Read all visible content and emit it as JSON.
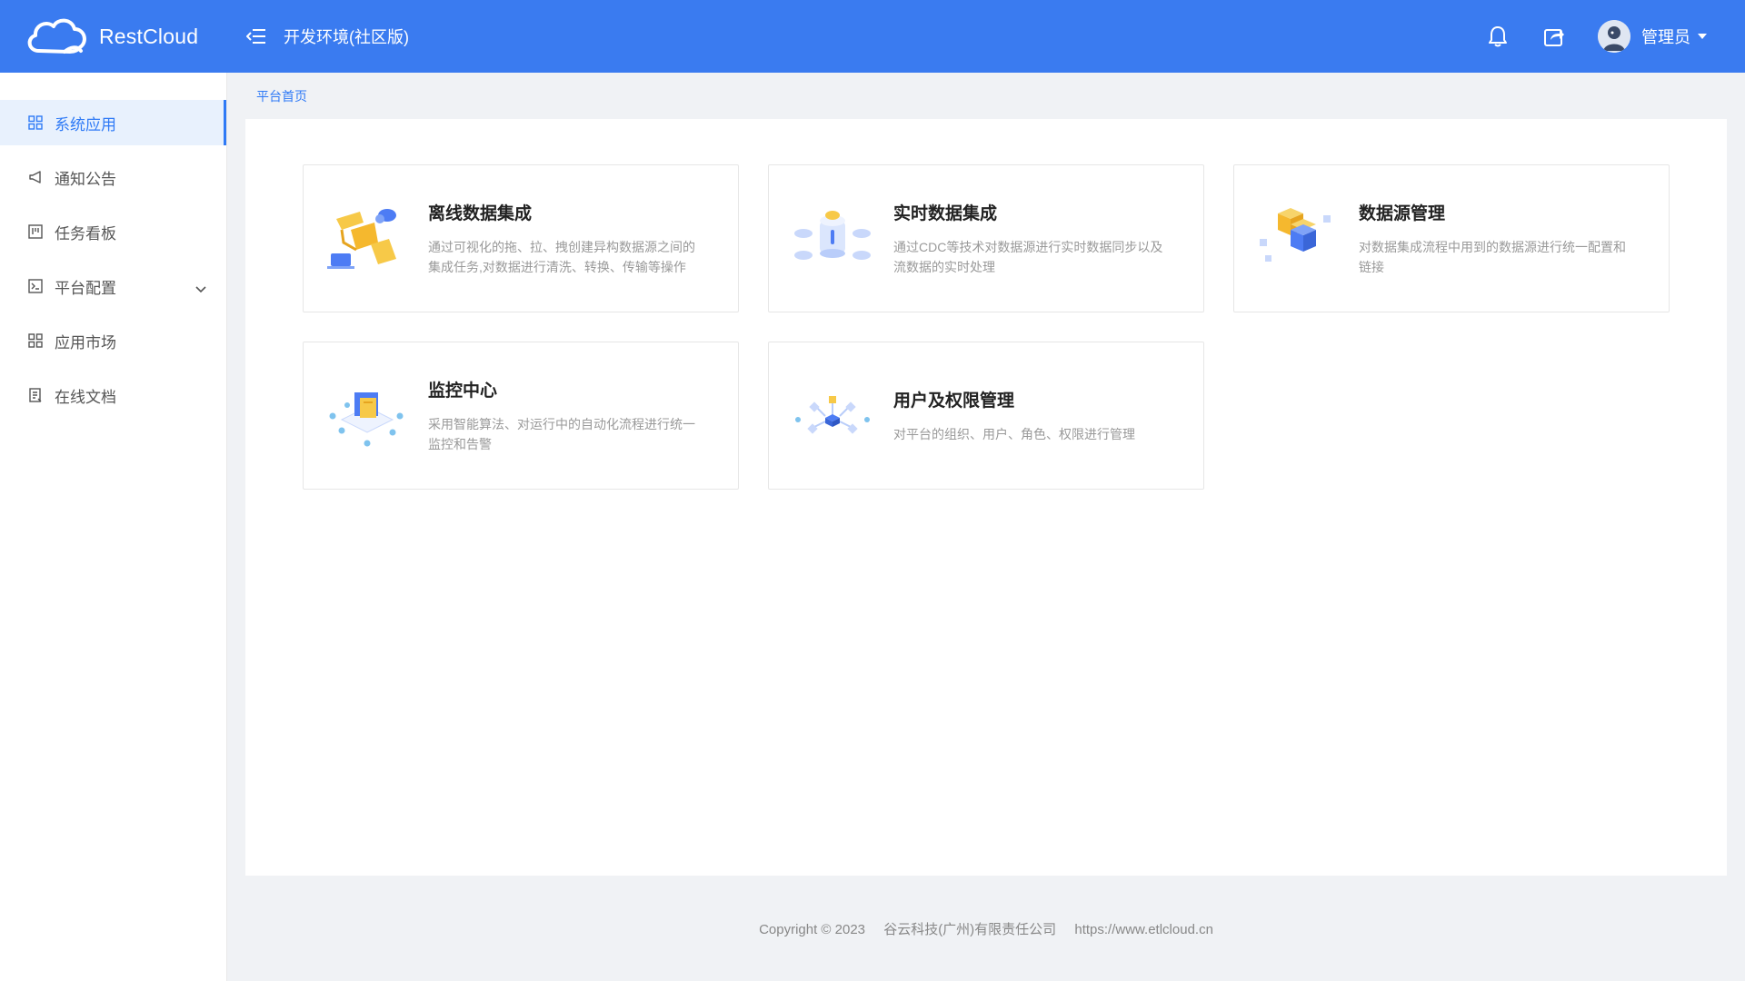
{
  "header": {
    "brand": "RestCloud",
    "env_title": "开发环境(社区版)",
    "user_name": "管理员",
    "icons": [
      "menu-fold-icon",
      "bell-icon",
      "share-icon"
    ]
  },
  "sidebar": {
    "items": [
      {
        "label": "系统应用",
        "icon": "grid-icon",
        "active": true
      },
      {
        "label": "通知公告",
        "icon": "megaphone-icon"
      },
      {
        "label": "任务看板",
        "icon": "kanban-icon"
      },
      {
        "label": "平台配置",
        "icon": "terminal-icon",
        "expandable": true
      },
      {
        "label": "应用市场",
        "icon": "grid-icon"
      },
      {
        "label": "在线文档",
        "icon": "document-icon"
      }
    ]
  },
  "breadcrumb": "平台首页",
  "cards": [
    {
      "title": "离线数据集成",
      "desc": "通过可视化的拖、拉、拽创建异构数据源之间的集成任务,对数据进行清洗、转换、传输等操作"
    },
    {
      "title": "实时数据集成",
      "desc": "通过CDC等技术对数据源进行实时数据同步以及流数据的实时处理"
    },
    {
      "title": "数据源管理",
      "desc": "对数据集成流程中用到的数据源进行统一配置和链接"
    },
    {
      "title": "监控中心",
      "desc": "采用智能算法、对运行中的自动化流程进行统一监控和告警"
    },
    {
      "title": "用户及权限管理",
      "desc": "对平台的组织、用户、角色、权限进行管理"
    }
  ],
  "footer": {
    "copyright": "Copyright © 2023",
    "company": "谷云科技(广州)有限责任公司",
    "url": "https://www.etlcloud.cn"
  },
  "colors": {
    "primary": "#3a7bf0",
    "accent": "#2f7af6"
  }
}
